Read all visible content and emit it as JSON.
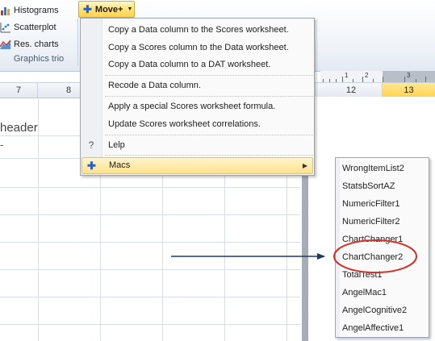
{
  "ribbon": {
    "histograms_label": "Histograms",
    "scatterplot_label": "Scatterplot",
    "res_charts_label": "Res. charts",
    "group_label": "Graphics trio",
    "move_button_label": "Move+"
  },
  "columns": [
    {
      "label": "7",
      "selected": false
    },
    {
      "label": "8",
      "selected": false
    },
    {
      "label": "12",
      "selected": false
    },
    {
      "label": "13",
      "selected": true
    }
  ],
  "ruler": {
    "n1": "1",
    "n2": "2",
    "n3": "3"
  },
  "sheet": {
    "header_text": "header",
    "tick_text": "-"
  },
  "menu": {
    "items": [
      {
        "label": "Copy a Data column to the Scores worksheet."
      },
      {
        "label": "Copy a Scores column to the Data worksheet."
      },
      {
        "label": "Copy a Data column to a DAT worksheet."
      },
      {
        "label": "Recode a Data column."
      },
      {
        "label": "Apply a special Scores worksheet formula."
      },
      {
        "label": "Update Scores worksheet correlations."
      },
      {
        "label": "Lelp",
        "icon": "question-icon"
      }
    ],
    "macs_label": "Macs",
    "macs_icon": "plus-icon"
  },
  "submenu": {
    "items": [
      {
        "label": "WrongItemList2"
      },
      {
        "label": "StatsbSortAZ"
      },
      {
        "label": "NumericFilter1"
      },
      {
        "label": "NumericFilter2"
      },
      {
        "label": "ChartChanger1"
      },
      {
        "label": "ChartChanger2",
        "highlighted": true
      },
      {
        "label": "TotalTest1"
      },
      {
        "label": "AngelMac1"
      },
      {
        "label": "AngelCognitive2"
      },
      {
        "label": "AngelAffective1"
      }
    ]
  },
  "colors": {
    "accent_yellow": "#ffd24f",
    "highlight_circle": "#d0342c",
    "arrow": "#1f3864"
  }
}
